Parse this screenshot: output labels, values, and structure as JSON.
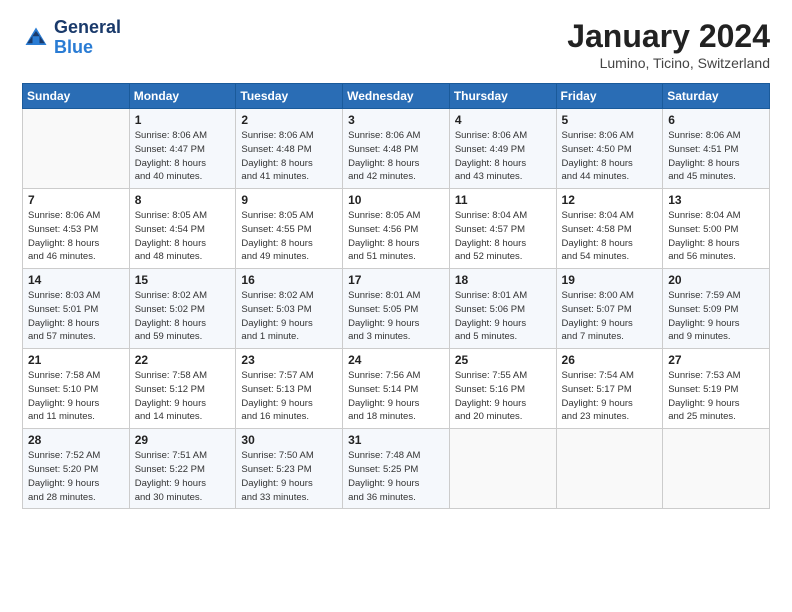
{
  "logo": {
    "line1": "General",
    "line2": "Blue"
  },
  "title": "January 2024",
  "subtitle": "Lumino, Ticino, Switzerland",
  "header": {
    "colors": {
      "bg": "#2a6db5"
    }
  },
  "weekdays": [
    "Sunday",
    "Monday",
    "Tuesday",
    "Wednesday",
    "Thursday",
    "Friday",
    "Saturday"
  ],
  "weeks": [
    [
      {
        "day": "",
        "content": ""
      },
      {
        "day": "1",
        "content": "Sunrise: 8:06 AM\nSunset: 4:47 PM\nDaylight: 8 hours\nand 40 minutes."
      },
      {
        "day": "2",
        "content": "Sunrise: 8:06 AM\nSunset: 4:48 PM\nDaylight: 8 hours\nand 41 minutes."
      },
      {
        "day": "3",
        "content": "Sunrise: 8:06 AM\nSunset: 4:48 PM\nDaylight: 8 hours\nand 42 minutes."
      },
      {
        "day": "4",
        "content": "Sunrise: 8:06 AM\nSunset: 4:49 PM\nDaylight: 8 hours\nand 43 minutes."
      },
      {
        "day": "5",
        "content": "Sunrise: 8:06 AM\nSunset: 4:50 PM\nDaylight: 8 hours\nand 44 minutes."
      },
      {
        "day": "6",
        "content": "Sunrise: 8:06 AM\nSunset: 4:51 PM\nDaylight: 8 hours\nand 45 minutes."
      }
    ],
    [
      {
        "day": "7",
        "content": "Sunrise: 8:06 AM\nSunset: 4:53 PM\nDaylight: 8 hours\nand 46 minutes."
      },
      {
        "day": "8",
        "content": "Sunrise: 8:05 AM\nSunset: 4:54 PM\nDaylight: 8 hours\nand 48 minutes."
      },
      {
        "day": "9",
        "content": "Sunrise: 8:05 AM\nSunset: 4:55 PM\nDaylight: 8 hours\nand 49 minutes."
      },
      {
        "day": "10",
        "content": "Sunrise: 8:05 AM\nSunset: 4:56 PM\nDaylight: 8 hours\nand 51 minutes."
      },
      {
        "day": "11",
        "content": "Sunrise: 8:04 AM\nSunset: 4:57 PM\nDaylight: 8 hours\nand 52 minutes."
      },
      {
        "day": "12",
        "content": "Sunrise: 8:04 AM\nSunset: 4:58 PM\nDaylight: 8 hours\nand 54 minutes."
      },
      {
        "day": "13",
        "content": "Sunrise: 8:04 AM\nSunset: 5:00 PM\nDaylight: 8 hours\nand 56 minutes."
      }
    ],
    [
      {
        "day": "14",
        "content": "Sunrise: 8:03 AM\nSunset: 5:01 PM\nDaylight: 8 hours\nand 57 minutes."
      },
      {
        "day": "15",
        "content": "Sunrise: 8:02 AM\nSunset: 5:02 PM\nDaylight: 8 hours\nand 59 minutes."
      },
      {
        "day": "16",
        "content": "Sunrise: 8:02 AM\nSunset: 5:03 PM\nDaylight: 9 hours\nand 1 minute."
      },
      {
        "day": "17",
        "content": "Sunrise: 8:01 AM\nSunset: 5:05 PM\nDaylight: 9 hours\nand 3 minutes."
      },
      {
        "day": "18",
        "content": "Sunrise: 8:01 AM\nSunset: 5:06 PM\nDaylight: 9 hours\nand 5 minutes."
      },
      {
        "day": "19",
        "content": "Sunrise: 8:00 AM\nSunset: 5:07 PM\nDaylight: 9 hours\nand 7 minutes."
      },
      {
        "day": "20",
        "content": "Sunrise: 7:59 AM\nSunset: 5:09 PM\nDaylight: 9 hours\nand 9 minutes."
      }
    ],
    [
      {
        "day": "21",
        "content": "Sunrise: 7:58 AM\nSunset: 5:10 PM\nDaylight: 9 hours\nand 11 minutes."
      },
      {
        "day": "22",
        "content": "Sunrise: 7:58 AM\nSunset: 5:12 PM\nDaylight: 9 hours\nand 14 minutes."
      },
      {
        "day": "23",
        "content": "Sunrise: 7:57 AM\nSunset: 5:13 PM\nDaylight: 9 hours\nand 16 minutes."
      },
      {
        "day": "24",
        "content": "Sunrise: 7:56 AM\nSunset: 5:14 PM\nDaylight: 9 hours\nand 18 minutes."
      },
      {
        "day": "25",
        "content": "Sunrise: 7:55 AM\nSunset: 5:16 PM\nDaylight: 9 hours\nand 20 minutes."
      },
      {
        "day": "26",
        "content": "Sunrise: 7:54 AM\nSunset: 5:17 PM\nDaylight: 9 hours\nand 23 minutes."
      },
      {
        "day": "27",
        "content": "Sunrise: 7:53 AM\nSunset: 5:19 PM\nDaylight: 9 hours\nand 25 minutes."
      }
    ],
    [
      {
        "day": "28",
        "content": "Sunrise: 7:52 AM\nSunset: 5:20 PM\nDaylight: 9 hours\nand 28 minutes."
      },
      {
        "day": "29",
        "content": "Sunrise: 7:51 AM\nSunset: 5:22 PM\nDaylight: 9 hours\nand 30 minutes."
      },
      {
        "day": "30",
        "content": "Sunrise: 7:50 AM\nSunset: 5:23 PM\nDaylight: 9 hours\nand 33 minutes."
      },
      {
        "day": "31",
        "content": "Sunrise: 7:48 AM\nSunset: 5:25 PM\nDaylight: 9 hours\nand 36 minutes."
      },
      {
        "day": "",
        "content": ""
      },
      {
        "day": "",
        "content": ""
      },
      {
        "day": "",
        "content": ""
      }
    ]
  ]
}
